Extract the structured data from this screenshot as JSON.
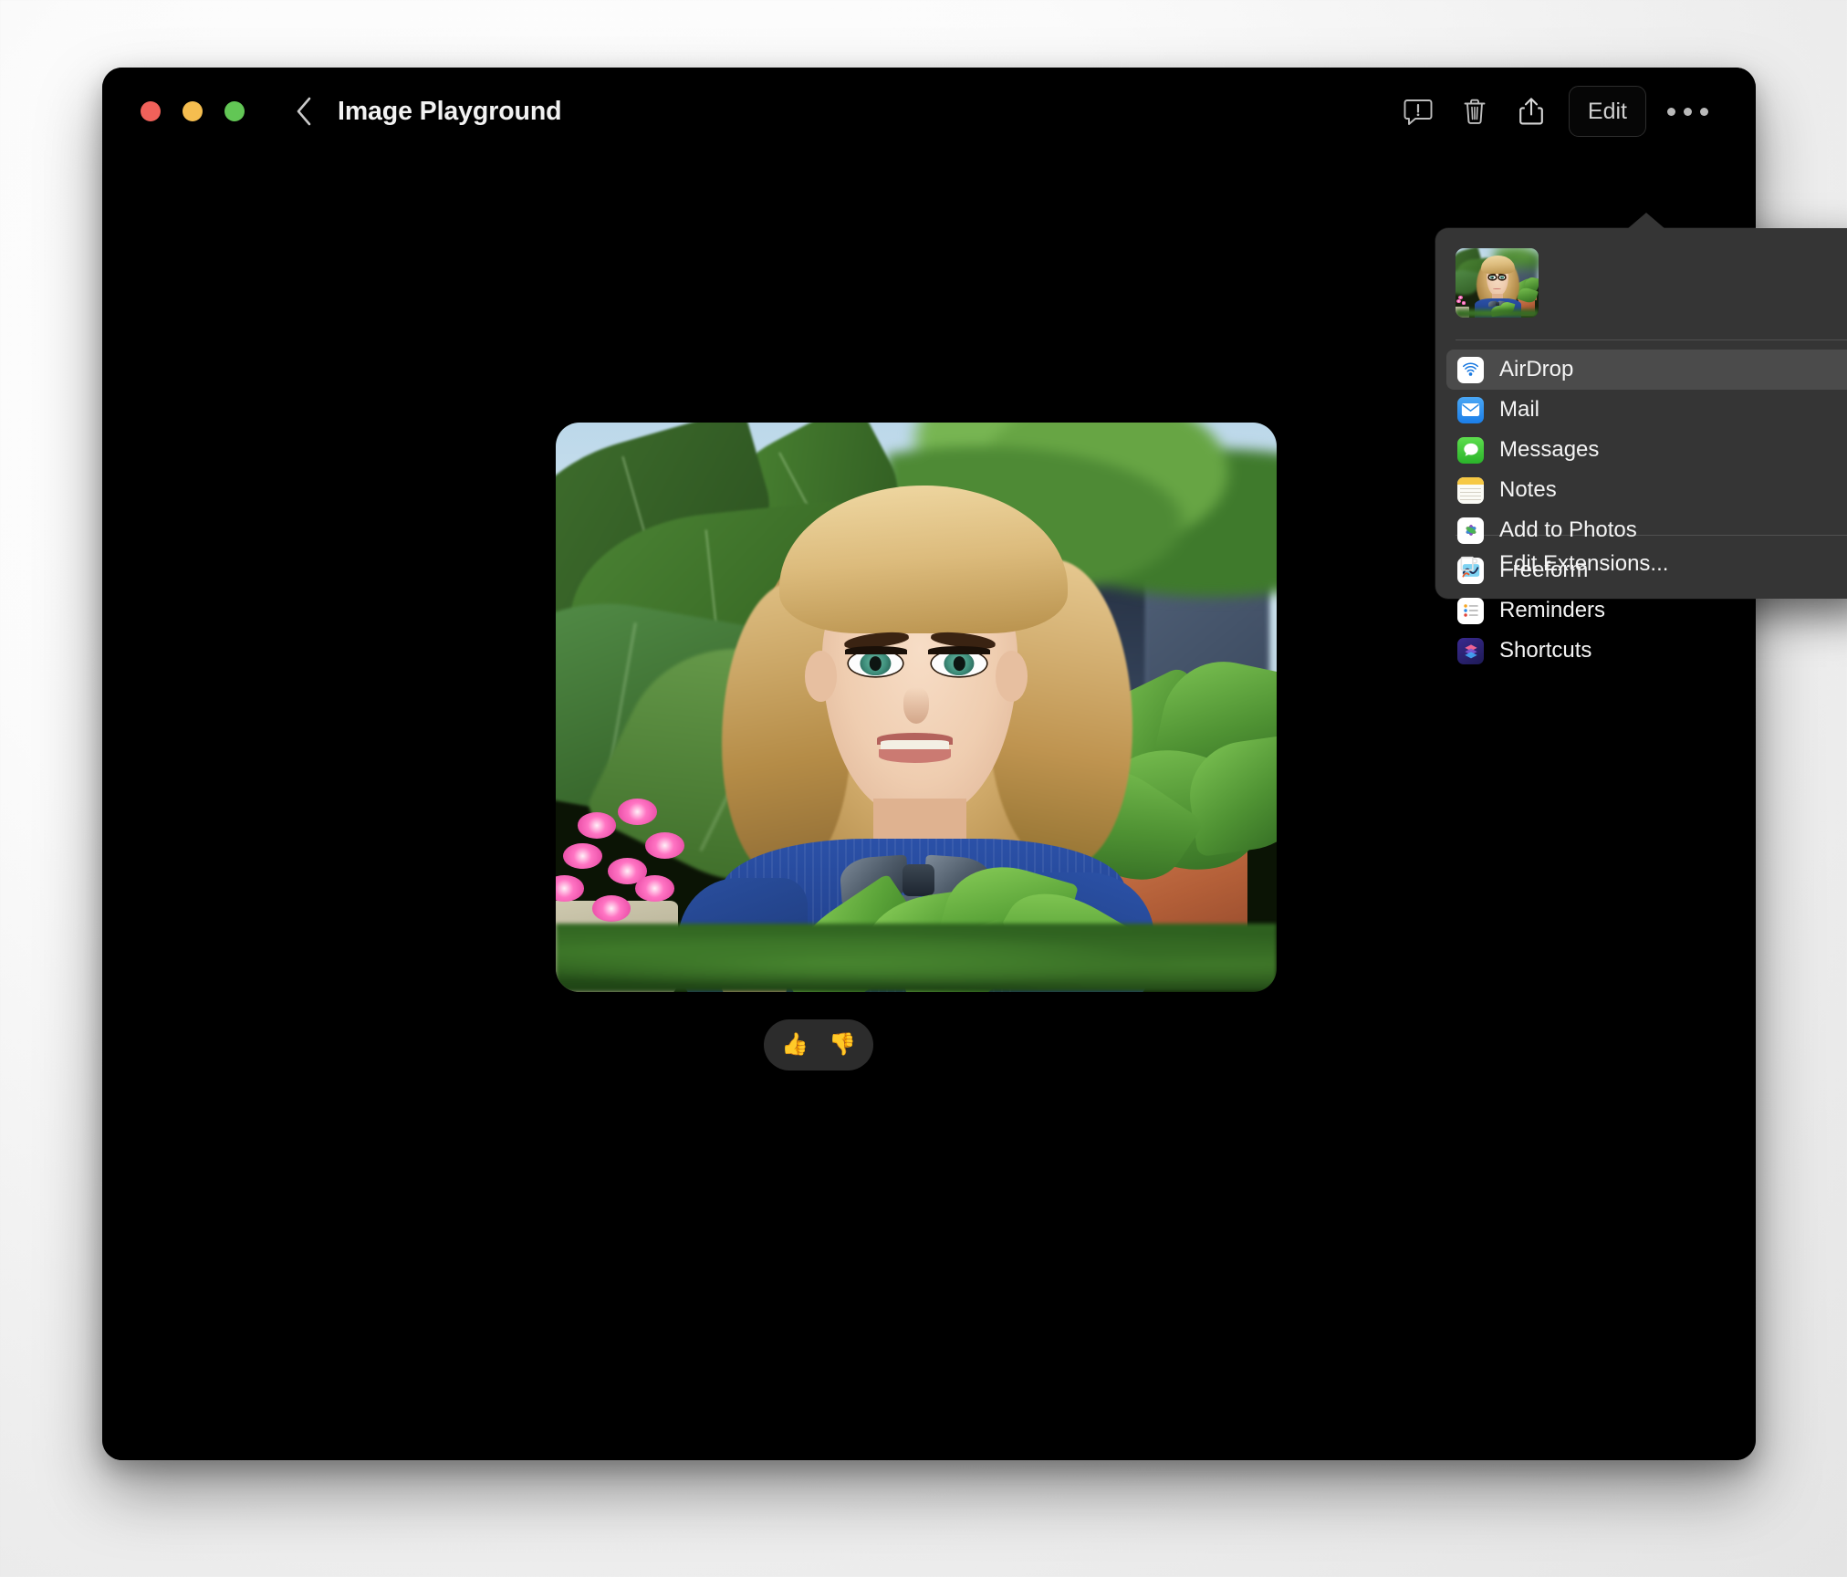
{
  "window": {
    "title": "Image Playground",
    "traffic_lights": [
      {
        "name": "close",
        "color": "#f0615a"
      },
      {
        "name": "minimize",
        "color": "#f5bd4f"
      },
      {
        "name": "maximize",
        "color": "#62c655"
      }
    ]
  },
  "toolbar": {
    "back_label": "Back",
    "report_label": "Report a Concern",
    "delete_label": "Delete",
    "share_label": "Share",
    "edit_label": "Edit",
    "more_label": "More"
  },
  "content": {
    "image_alt": "AI generated portrait of a smiling blonde woman in a blue sweater with a gray bow tie, surrounded by green tropical plants, pink flowers and a terracotta pot",
    "feedback": {
      "thumbs_up": "👍",
      "thumbs_down": "👎"
    }
  },
  "share_popover": {
    "thumbnail_alt": "Shared image preview",
    "items": [
      {
        "label": "AirDrop",
        "icon": "airdrop-icon",
        "selected": true
      },
      {
        "label": "Mail",
        "icon": "mail-icon",
        "selected": false
      },
      {
        "label": "Messages",
        "icon": "messages-icon",
        "selected": false
      },
      {
        "label": "Notes",
        "icon": "notes-icon",
        "selected": false
      },
      {
        "label": "Add to Photos",
        "icon": "photos-icon",
        "selected": false
      },
      {
        "label": "Freeform",
        "icon": "freeform-icon",
        "selected": false
      },
      {
        "label": "Reminders",
        "icon": "reminders-icon",
        "selected": false
      },
      {
        "label": "Shortcuts",
        "icon": "shortcuts-icon",
        "selected": false
      }
    ],
    "edit_extensions_label": "Edit Extensions...",
    "selected_background": "#4b4b4b",
    "background": "#353535"
  }
}
